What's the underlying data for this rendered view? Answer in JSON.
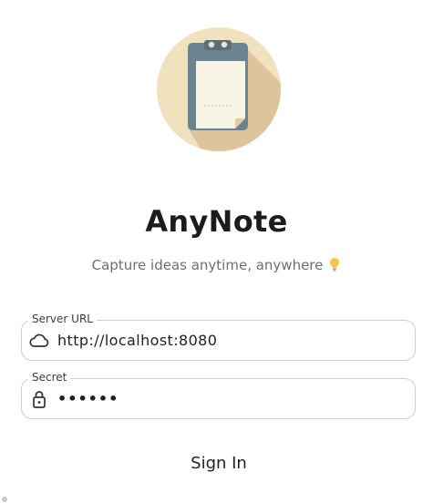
{
  "app": {
    "title": "AnyNote",
    "tagline": "Capture ideas anytime, anywhere",
    "tagline_icon": "lightbulb-icon"
  },
  "form": {
    "server_url": {
      "label": "Server URL",
      "value": "http://localhost:8080",
      "icon": "cloud-icon"
    },
    "secret": {
      "label": "Secret",
      "value": "••••••",
      "icon": "lock-icon"
    },
    "submit_label": "Sign In"
  },
  "colors": {
    "logo_circle": "#F1E2BF",
    "logo_shadow": "#D9BE96",
    "clipboard": "#6B8590",
    "paper": "#F8F4E6",
    "accent_text": "#6f6f6f"
  }
}
